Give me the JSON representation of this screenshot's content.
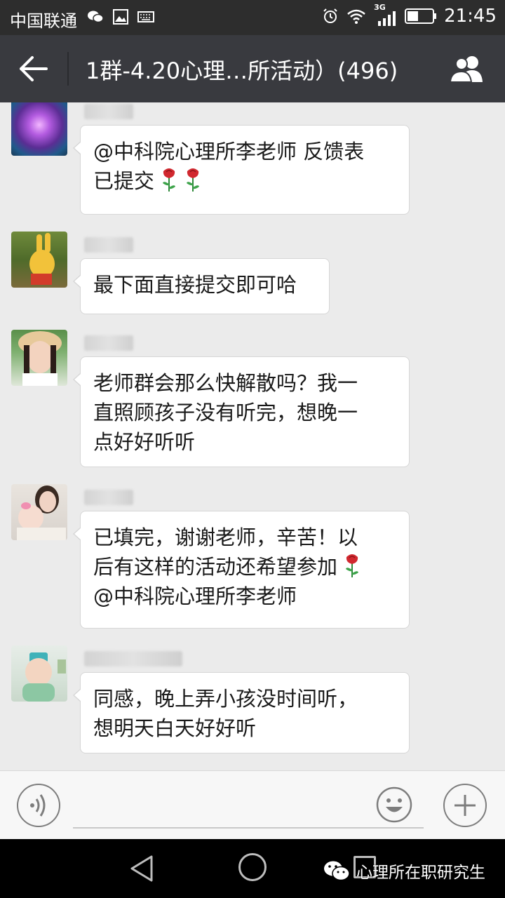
{
  "status_bar": {
    "carrier": "中国联通",
    "network": "3G",
    "time": "21:45",
    "icons": [
      "wechat-icon",
      "gallery-icon",
      "keyboard-icon",
      "alarm-icon",
      "wifi-icon",
      "signal-icon",
      "battery-icon"
    ]
  },
  "header": {
    "title": "1群-4.20心理…所活动）(496)",
    "back_icon": "arrow-left-icon",
    "members_icon": "group-members-icon"
  },
  "messages": [
    {
      "lines": [
        "@中科院心理所李老师 反馈表",
        "已提交"
      ],
      "trailing_icons": [
        "rose-icon",
        "rose-icon"
      ]
    },
    {
      "lines": [
        "最下面直接提交即可哈"
      ],
      "trailing_icons": []
    },
    {
      "lines": [
        "老师群会那么快解散吗？我一",
        "直照顾孩子没有听完，想晚一",
        "点好好听听"
      ],
      "trailing_icons": []
    },
    {
      "lines": [
        "已填完，谢谢老师，辛苦！以",
        "后有这样的活动还希望参加",
        "@中科院心理所李老师"
      ],
      "line2_icon": "rose-icon"
    },
    {
      "lines": [
        "同感，晚上弄小孩没时间听，",
        "想明天白天好好听"
      ],
      "trailing_icons": []
    }
  ],
  "input_bar": {
    "voice_icon": "voice-icon",
    "emoji_icon": "emoji-icon",
    "plus_icon": "plus-icon"
  },
  "nav_bar": {
    "icons": [
      "nav-back-icon",
      "nav-home-icon",
      "nav-recent-icon"
    ]
  },
  "watermark": {
    "text": "心理所在职研究生",
    "icon": "wechat-logo-icon"
  },
  "colors": {
    "status_bar": "#2d2d2d",
    "title_bar": "#393a3f",
    "chat_background": "#ebebeb",
    "bubble": "#ffffff",
    "rose": "#d1282f"
  }
}
